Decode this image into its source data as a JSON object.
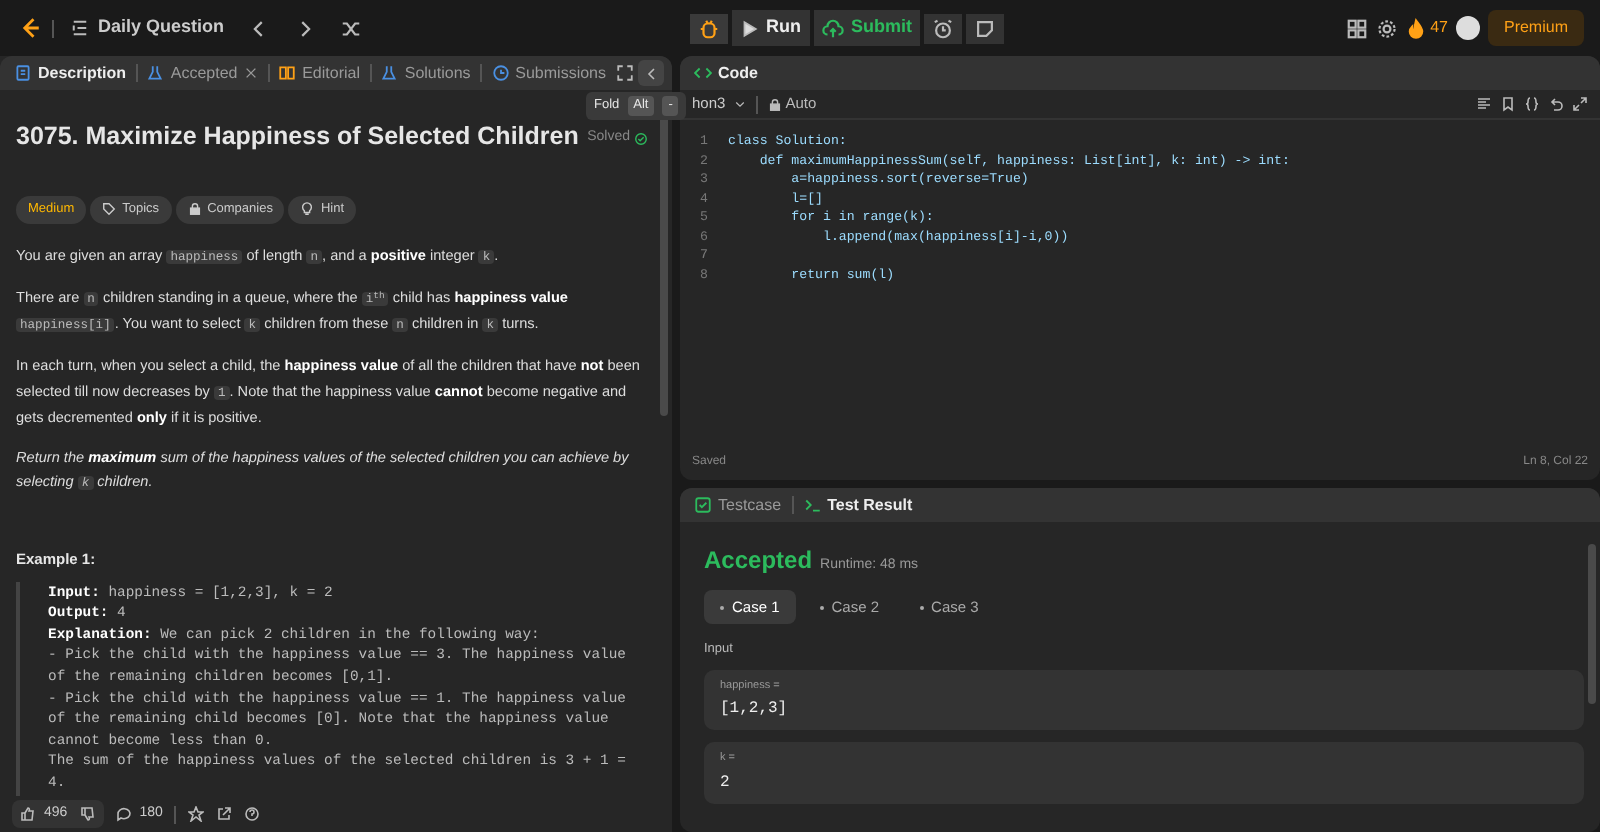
{
  "topbar": {
    "title": "Daily Question",
    "run": "Run",
    "submit": "Submit",
    "streak": "47",
    "premium": "Premium"
  },
  "left_tabs": [
    {
      "label": "Description",
      "selected": true,
      "closable": false
    },
    {
      "label": "Accepted",
      "selected": false,
      "closable": true
    },
    {
      "label": "Editorial",
      "selected": false,
      "closable": false
    },
    {
      "label": "Solutions",
      "selected": false,
      "closable": false
    },
    {
      "label": "Submissions",
      "selected": false,
      "closable": false
    }
  ],
  "tooltip": {
    "text": "Fold",
    "keys": [
      "Alt",
      "-"
    ]
  },
  "problem": {
    "title": "3075. Maximize Happiness of Selected Children",
    "status": "Solved",
    "difficulty": "Medium",
    "chips": [
      "Topics",
      "Companies",
      "Hint"
    ],
    "paragraphs": [
      {
        "italic": false,
        "parts": [
          {
            "kind": "text",
            "t": "You are given an array "
          },
          {
            "kind": "code",
            "t": "happiness"
          },
          {
            "kind": "text",
            "t": " of length "
          },
          {
            "kind": "code",
            "t": "n"
          },
          {
            "kind": "text",
            "t": ", and a **positive** integer "
          },
          {
            "kind": "code",
            "t": "k"
          },
          {
            "kind": "text",
            "t": "."
          }
        ]
      },
      {
        "italic": false,
        "parts": [
          {
            "kind": "text",
            "t": "There are "
          },
          {
            "kind": "code",
            "t": "n"
          },
          {
            "kind": "text",
            "t": " children standing in a queue, where the "
          },
          {
            "kind": "code",
            "t": "i$^{th}$"
          },
          {
            "kind": "text",
            "t": " child has **happiness value** "
          },
          {
            "kind": "code",
            "t": "happiness[i]"
          },
          {
            "kind": "text",
            "t": ". You want to select "
          },
          {
            "kind": "code",
            "t": "k"
          },
          {
            "kind": "text",
            "t": " children from these "
          },
          {
            "kind": "code",
            "t": "n"
          },
          {
            "kind": "text",
            "t": " children in "
          },
          {
            "kind": "code",
            "t": "k"
          },
          {
            "kind": "text",
            "t": " turns."
          }
        ]
      },
      {
        "italic": false,
        "parts": [
          {
            "kind": "text",
            "t": "In each turn, when you select a child, the **happiness value** of all the children that have **not** been selected till now decreases by "
          },
          {
            "kind": "code",
            "t": "1"
          },
          {
            "kind": "text",
            "t": ". Note that the happiness value **cannot** become negative and gets decremented **only** if it is positive."
          }
        ]
      },
      {
        "italic": true,
        "parts": [
          {
            "kind": "text",
            "t": "Return the **maximum** sum of the happiness values of the selected children you can achieve by selecting "
          },
          {
            "kind": "code",
            "t": "k"
          },
          {
            "kind": "text",
            "t": " children."
          }
        ]
      }
    ],
    "example": {
      "heading": "Example 1:",
      "lines": [
        "**Input:** happiness = [1,2,3], k = 2",
        "**Output:** 4",
        "**Explanation:** We can pick 2 children in the following way:",
        "- Pick the child with the happiness value == 3. The happiness value of the remaining children becomes [0,1].",
        "- Pick the child with the happiness value == 1. The happiness value of the remaining child becomes [0]. Note that the happiness value cannot become less than 0.",
        "The sum of the happiness values of the selected children is 3 + 1 = 4."
      ]
    },
    "likes": "496",
    "comments": "180"
  },
  "code_panel": {
    "title": "Code",
    "language": "hon3",
    "mode": "Auto",
    "lines": [
      {
        "n": "1",
        "t": "class Solution:"
      },
      {
        "n": "2",
        "t": "    def maximumHappinessSum(self, happiness: List[int], k: int) -> int:"
      },
      {
        "n": "3",
        "t": "        a=happiness.sort(reverse=True)"
      },
      {
        "n": "4",
        "t": "        l=[]"
      },
      {
        "n": "5",
        "t": "        for i in range(k):"
      },
      {
        "n": "6",
        "t": "            l.append(max(happiness[i]-i,0))"
      },
      {
        "n": "7"
      },
      {
        "n": "8",
        "t": "        return sum(l)"
      }
    ],
    "status": "Saved",
    "cursor": "Ln 8, Col 22"
  },
  "test_panel": {
    "tabs": [
      {
        "label": "Testcase",
        "selected": false
      },
      {
        "label": "Test Result",
        "selected": true
      }
    ],
    "verdict": "Accepted",
    "runtime": "Runtime: 48 ms",
    "cases": [
      {
        "label": "Case 1",
        "selected": true
      },
      {
        "label": "Case 2",
        "selected": false
      },
      {
        "label": "Case 3",
        "selected": false
      }
    ],
    "input_label": "Input",
    "inputs": [
      {
        "name": "happiness =",
        "value": "[1,2,3]"
      },
      {
        "name": "k =",
        "value": "2"
      }
    ]
  }
}
